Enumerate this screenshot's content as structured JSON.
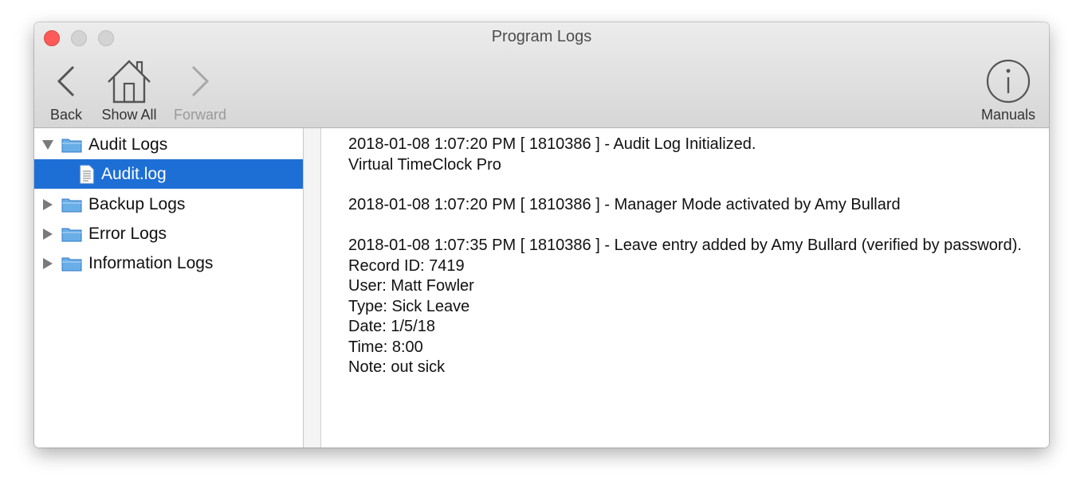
{
  "window": {
    "title": "Program Logs"
  },
  "toolbar": {
    "back_label": "Back",
    "show_all_label": "Show All",
    "forward_label": "Forward",
    "manuals_label": "Manuals"
  },
  "sidebar": {
    "items": [
      {
        "label": "Audit Logs",
        "expanded": true
      },
      {
        "label": "Audit.log",
        "selected": true
      },
      {
        "label": "Backup Logs",
        "expanded": false
      },
      {
        "label": "Error Logs",
        "expanded": false
      },
      {
        "label": "Information Logs",
        "expanded": false
      }
    ]
  },
  "log": {
    "entries": [
      "2018-01-08 1:07:20 PM [ 1810386 ] - Audit Log Initialized.\nVirtual TimeClock Pro",
      "2018-01-08 1:07:20 PM [ 1810386 ] - Manager Mode activated by Amy Bullard",
      "2018-01-08 1:07:35 PM [ 1810386 ] - Leave entry added by Amy Bullard (verified by password).\nRecord ID: 7419\nUser: Matt Fowler\nType: Sick Leave\nDate: 1/5/18\nTime: 8:00\nNote: out sick"
    ]
  },
  "colors": {
    "selection": "#1e6fd5",
    "close_button": "#fc5b57",
    "folder": "#6aaee8"
  }
}
